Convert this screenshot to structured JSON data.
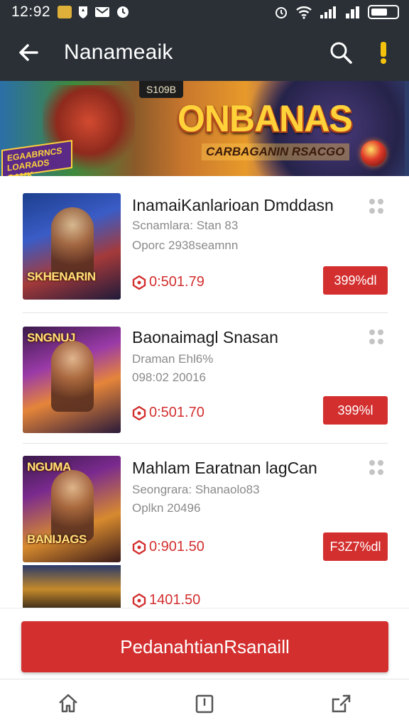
{
  "status_bar": {
    "time": "12:92"
  },
  "app_bar": {
    "title": "Nanameaik",
    "icons": [
      "back-arrow-icon",
      "search-icon",
      "alert-icon"
    ]
  },
  "banner": {
    "badge": "S109B",
    "title": "ONBANAS",
    "subtitle": "CARBAGANIN RSACGO",
    "ribbon": "EGAABRNCS\nLOARADS GAMK"
  },
  "games": [
    {
      "title": "InamaiKanlarioan Dmddasn",
      "meta_1": "Scnamlara: Stan 83",
      "meta_2": "Oporc 2938seamnn",
      "price": "0:501.79",
      "button": "399%dl",
      "thumb_logo": "SKHENARIN"
    },
    {
      "title": "Baonaimagl Snasan",
      "meta_1": "Draman Ehl6%",
      "meta_2": "098:02 20016",
      "price": "0:501.70",
      "button": "399%l",
      "thumb_logo": "SNGNUJ"
    },
    {
      "title": "Mahlam Earatnan lagCan",
      "meta_1": "Seongrara: Shanaolo83",
      "meta_2": "Oplkn 20496",
      "price": "0:901.50",
      "button": "F3Z7%dl",
      "thumb_logo_top": "NGUMA",
      "thumb_logo": "BANIJAGS"
    }
  ],
  "partial_price": "1401.50",
  "primary_button": "PedanahtianRsanaill",
  "bottom_nav": [
    "home-icon",
    "bookmark-icon",
    "share-icon"
  ],
  "colors": {
    "accent": "#d32f2f",
    "app_bar": "#2a3036",
    "meta_text": "#8a8a8a"
  }
}
